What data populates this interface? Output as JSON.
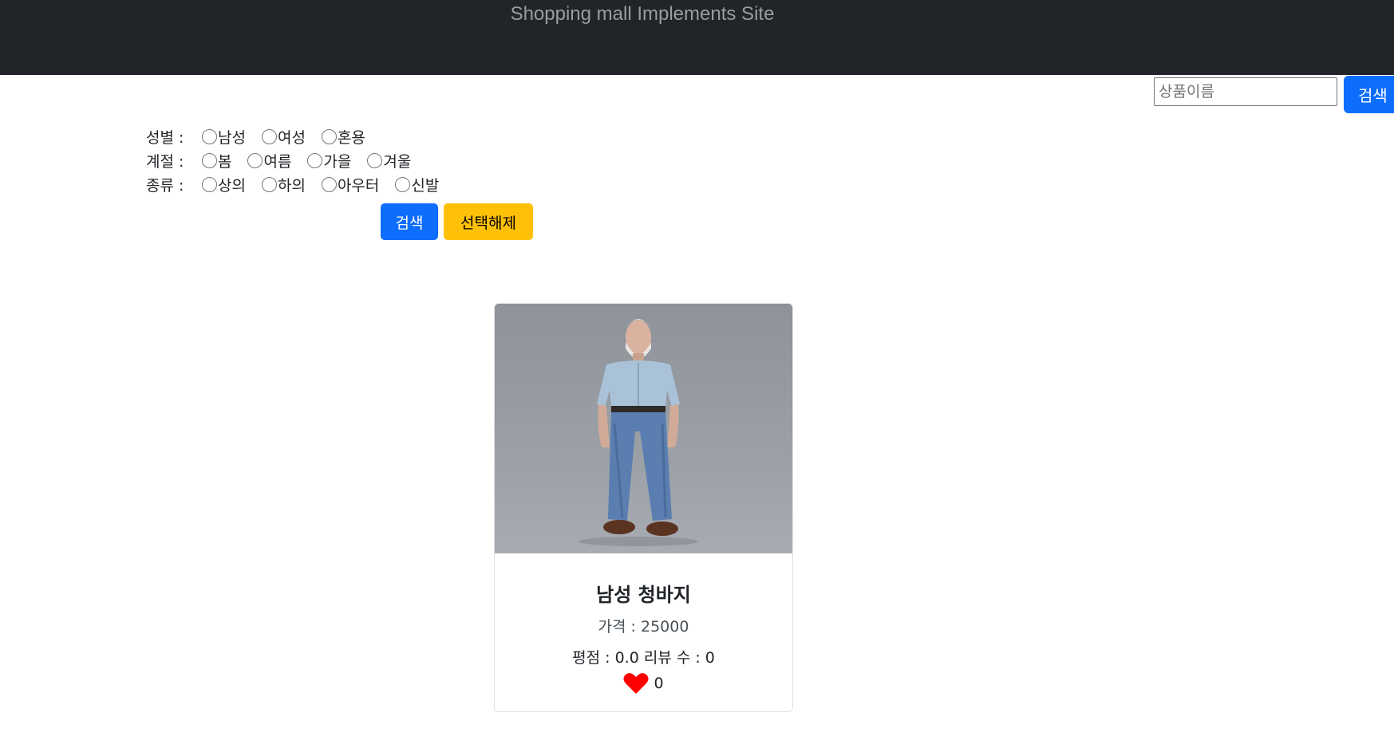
{
  "header": {
    "title": "Shopping mall Implements Site"
  },
  "search": {
    "placeholder": "상품이름",
    "button_label": "검색"
  },
  "filters": {
    "gender": {
      "label": "성별 :",
      "options": [
        "남성",
        "여성",
        "혼용"
      ]
    },
    "season": {
      "label": "계절 :",
      "options": [
        "봄",
        "여름",
        "가을",
        "겨울"
      ]
    },
    "category": {
      "label": "종류 :",
      "options": [
        "상의",
        "하의",
        "아우터",
        "신발"
      ]
    }
  },
  "actions": {
    "search_label": "검색",
    "clear_label": "선택해제"
  },
  "products": [
    {
      "name": "남성 청바지",
      "price": "가격 : 25000",
      "rating": "평점 : 0.0 리뷰 수 : 0",
      "likes": "0"
    }
  ],
  "colors": {
    "primary": "#0d6efd",
    "warning": "#ffc107",
    "navbar": "#212529",
    "heart": "#ff0000"
  }
}
